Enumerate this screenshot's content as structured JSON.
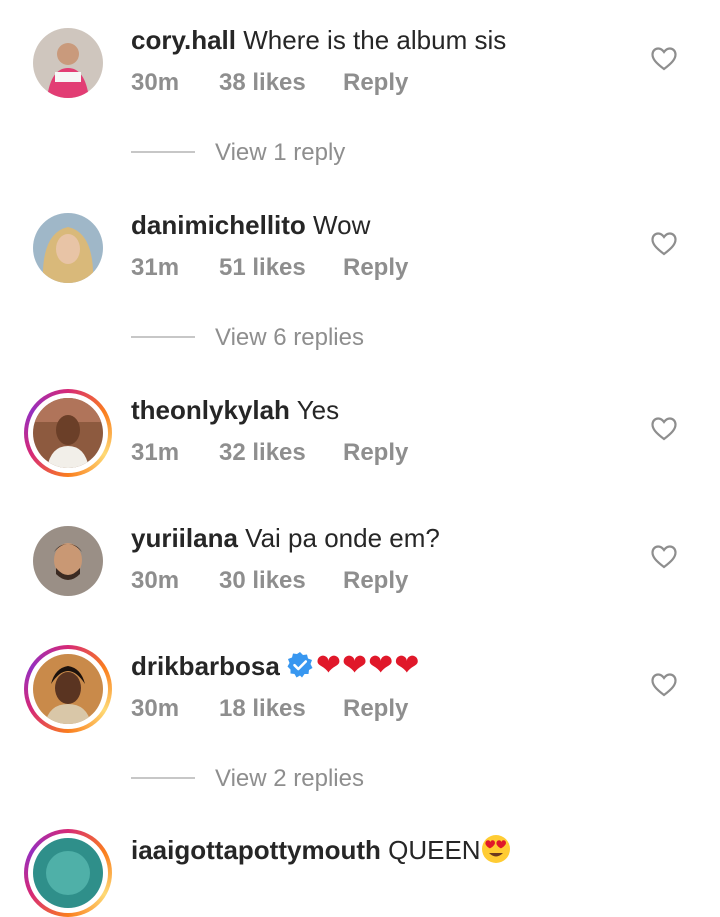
{
  "comments": [
    {
      "username": "cory.hall",
      "text": "Where is the album sis",
      "time": "30m",
      "likes": "38 likes",
      "reply": "Reply",
      "view_replies": "View 1 reply"
    },
    {
      "username": "danimichellito",
      "text": "Wow",
      "time": "31m",
      "likes": "51 likes",
      "reply": "Reply",
      "view_replies": "View 6 replies"
    },
    {
      "username": "theonlykylah",
      "text": "Yes",
      "time": "31m",
      "likes": "32 likes",
      "reply": "Reply"
    },
    {
      "username": "yuriilana",
      "text": "Vai pa onde em?",
      "time": "30m",
      "likes": "30 likes",
      "reply": "Reply"
    },
    {
      "username": "drikbarbosa",
      "text": "❤❤❤❤",
      "time": "30m",
      "likes": "18 likes",
      "reply": "Reply",
      "view_replies": "View 2 replies"
    },
    {
      "username": "iaaigottapottymouth",
      "text": "QUEEN"
    }
  ],
  "icons": {
    "like": "heart-outline-icon",
    "verified": "verified-badge-icon",
    "emoji": "heart-eyes-emoji"
  },
  "colors": {
    "verified": "#3897f0",
    "red_heart": "#e0182a",
    "muted": "#8e8e8e"
  }
}
